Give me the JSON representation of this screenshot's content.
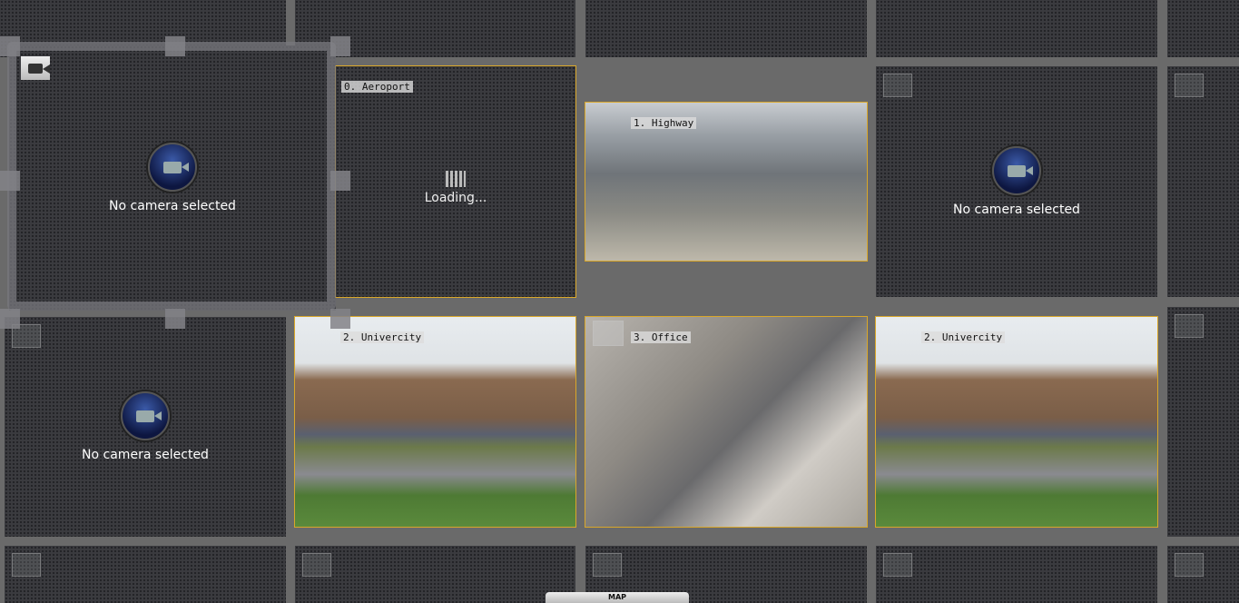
{
  "cells": {
    "no_camera_text": "No camera selected",
    "loading_text": "Loading...",
    "cam_aeroport": "0. Aeroport",
    "cam_highway": "1. Highway",
    "cam_univercity_a": "2. Univercity",
    "cam_office": "3. Office",
    "cam_univercity_b": "2. Univercity"
  },
  "footer": {
    "map_label": "MAP"
  },
  "colors": {
    "selected_border": "#d9a72a",
    "cell_bg": "#3a3b3f",
    "accent_camera": "#3b5aa8"
  }
}
